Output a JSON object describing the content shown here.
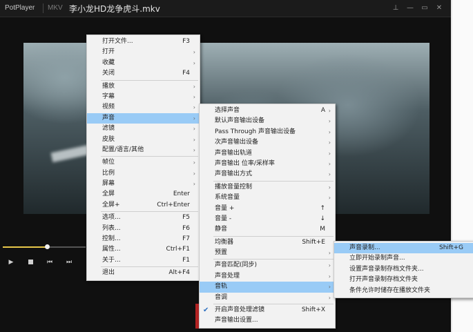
{
  "titlebar": {
    "app_name": "PotPlayer",
    "format": "MKV",
    "filename": "李小龙HD龙争虎斗.mkv",
    "buttons": [
      {
        "icon": "pin-icon",
        "glyph": "⊥"
      },
      {
        "icon": "minimize-icon",
        "glyph": "—"
      },
      {
        "icon": "maximize-icon",
        "glyph": "▭"
      },
      {
        "icon": "close-icon",
        "glyph": "✕"
      }
    ]
  },
  "playback": {
    "progress": 0.53,
    "controls": [
      {
        "icon": "play-icon",
        "glyph": "▶"
      },
      {
        "icon": "stop-icon",
        "glyph": ""
      },
      {
        "icon": "previous-icon",
        "glyph": "⏮"
      },
      {
        "icon": "next-icon",
        "glyph": "⏭"
      }
    ]
  },
  "main_menu": [
    {
      "label": "打开文件...",
      "shortcut": "F3"
    },
    {
      "label": "打开",
      "submenu": true
    },
    {
      "label": "收藏",
      "submenu": true
    },
    {
      "label": "关闭",
      "shortcut": "F4"
    },
    {
      "separator": true
    },
    {
      "label": "播放",
      "submenu": true
    },
    {
      "label": "字幕",
      "submenu": true
    },
    {
      "label": "视频",
      "submenu": true
    },
    {
      "label": "声音",
      "submenu": true,
      "highlighted": true
    },
    {
      "label": "滤镜",
      "submenu": true
    },
    {
      "label": "皮肤",
      "submenu": true
    },
    {
      "label": "配置/语言/其他",
      "submenu": true
    },
    {
      "separator": true
    },
    {
      "label": "帧位",
      "submenu": true
    },
    {
      "label": "比例",
      "submenu": true
    },
    {
      "label": "屏幕",
      "submenu": true
    },
    {
      "label": "全屏",
      "shortcut": "Enter"
    },
    {
      "label": "全屏+",
      "shortcut": "Ctrl+Enter"
    },
    {
      "separator": true
    },
    {
      "label": "选项...",
      "shortcut": "F5"
    },
    {
      "label": "列表...",
      "shortcut": "F6"
    },
    {
      "label": "控制...",
      "shortcut": "F7"
    },
    {
      "label": "属性...",
      "shortcut": "Ctrl+F1"
    },
    {
      "label": "关于...",
      "shortcut": "F1"
    },
    {
      "separator": true
    },
    {
      "label": "退出",
      "shortcut": "Alt+F4"
    }
  ],
  "sound_menu": [
    {
      "label": "选择声音",
      "shortcut": "A",
      "submenu": true
    },
    {
      "label": "默认声音输出设备",
      "submenu": true
    },
    {
      "label": "Pass Through 声音输出设备",
      "submenu": true
    },
    {
      "label": "次声音输出设备",
      "submenu": true
    },
    {
      "label": "声音输出轨道",
      "submenu": true
    },
    {
      "label": "声音输出 位率/采样率",
      "submenu": true
    },
    {
      "label": "声音输出方式",
      "submenu": true
    },
    {
      "separator": true
    },
    {
      "label": "播放音量控制",
      "submenu": true
    },
    {
      "label": "系统音量",
      "submenu": true
    },
    {
      "label": "音量 +",
      "shortcut": "↑"
    },
    {
      "label": "音量 -",
      "shortcut": "↓"
    },
    {
      "label": "静音",
      "shortcut": "M"
    },
    {
      "separator": true
    },
    {
      "label": "均衡器",
      "shortcut": "Shift+E"
    },
    {
      "label": "预置",
      "submenu": true
    },
    {
      "separator": true
    },
    {
      "label": "声音匹配(同步)",
      "submenu": true
    },
    {
      "label": "声音处理",
      "submenu": true
    },
    {
      "label": "音轨",
      "submenu": true,
      "highlighted": true
    },
    {
      "label": "音调",
      "submenu": true
    },
    {
      "separator": true
    },
    {
      "label": "开启声音处理滤镜",
      "shortcut": "Shift+X",
      "checked": true
    },
    {
      "label": "声音输出设置..."
    }
  ],
  "track_menu": [
    {
      "label": "声音录制...",
      "shortcut": "Shift+G",
      "highlighted": true
    },
    {
      "label": "立即开始录制声音..."
    },
    {
      "label": "设置声音录制存档文件夹..."
    },
    {
      "label": "打开声音录制存档文件夹"
    },
    {
      "label": "条件允许时储存在播放文件夹"
    }
  ]
}
